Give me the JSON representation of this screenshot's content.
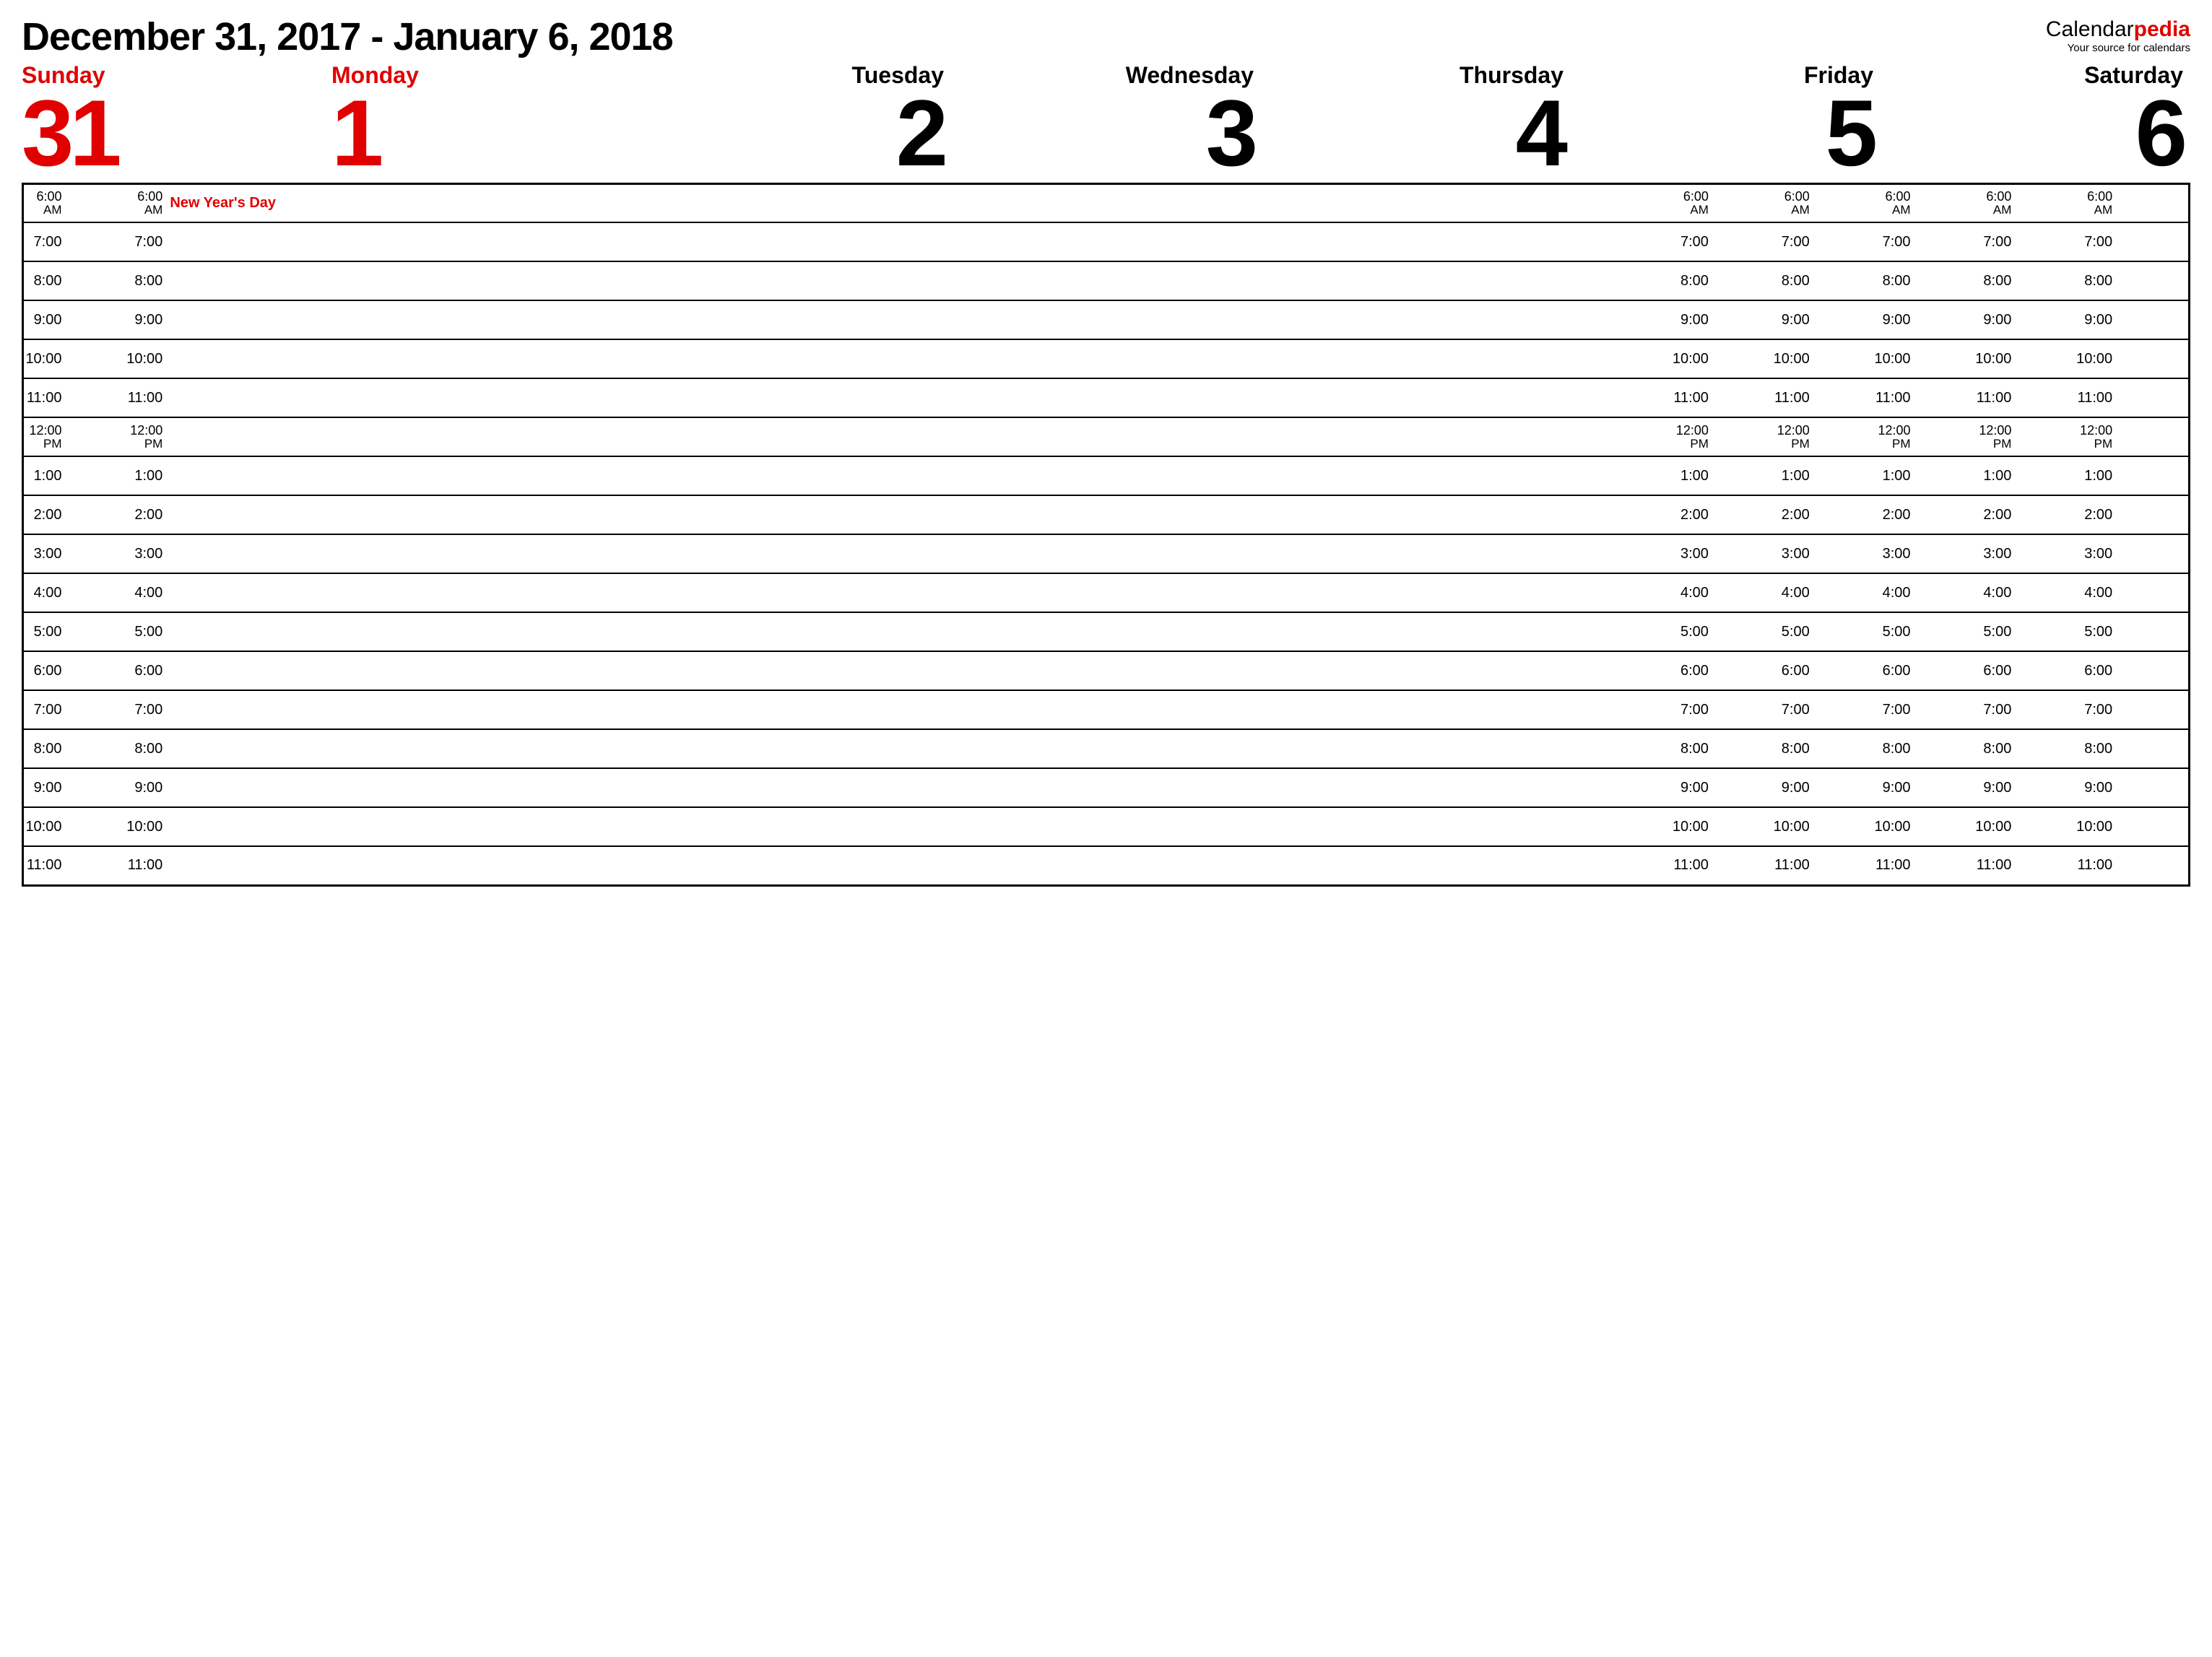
{
  "title": "December 31, 2017 - January 6, 2018",
  "logo": {
    "part1": "Calendar",
    "part2": "pedia",
    "tagline": "Your source for calendars"
  },
  "days": [
    {
      "name": "Sunday",
      "num": "31",
      "weekend": true
    },
    {
      "name": "Monday",
      "num": "1",
      "weekend": true
    },
    {
      "name": "Tuesday",
      "num": "2",
      "weekend": false
    },
    {
      "name": "Wednesday",
      "num": "3",
      "weekend": false
    },
    {
      "name": "Thursday",
      "num": "4",
      "weekend": false
    },
    {
      "name": "Friday",
      "num": "5",
      "weekend": false
    },
    {
      "name": "Saturday",
      "num": "6",
      "weekend": false
    }
  ],
  "times": [
    {
      "label": "6:00",
      "suffix": "AM"
    },
    {
      "label": "7:00",
      "suffix": ""
    },
    {
      "label": "8:00",
      "suffix": ""
    },
    {
      "label": "9:00",
      "suffix": ""
    },
    {
      "label": "10:00",
      "suffix": ""
    },
    {
      "label": "11:00",
      "suffix": ""
    },
    {
      "label": "12:00",
      "suffix": "PM"
    },
    {
      "label": "1:00",
      "suffix": ""
    },
    {
      "label": "2:00",
      "suffix": ""
    },
    {
      "label": "3:00",
      "suffix": ""
    },
    {
      "label": "4:00",
      "suffix": ""
    },
    {
      "label": "5:00",
      "suffix": ""
    },
    {
      "label": "6:00",
      "suffix": ""
    },
    {
      "label": "7:00",
      "suffix": ""
    },
    {
      "label": "8:00",
      "suffix": ""
    },
    {
      "label": "9:00",
      "suffix": ""
    },
    {
      "label": "10:00",
      "suffix": ""
    },
    {
      "label": "11:00",
      "suffix": ""
    }
  ],
  "events": {
    "0": {
      "1": "New Year's Day"
    }
  }
}
